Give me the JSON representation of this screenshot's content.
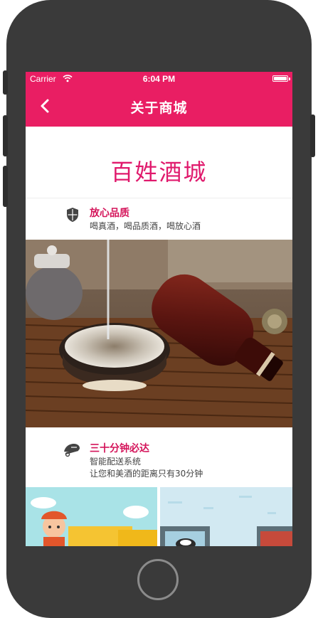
{
  "status_bar": {
    "carrier": "Carrier",
    "time": "6:04 PM"
  },
  "nav": {
    "title": "关于商城"
  },
  "brand": {
    "title": "百姓酒城"
  },
  "features": [
    {
      "title": "放心品质",
      "lines": [
        "喝真酒，喝品质酒，喝放心酒"
      ]
    },
    {
      "title": "三十分钟必达",
      "lines": [
        "智能配送系统",
        "让您和美酒的距离只有30分钟"
      ]
    }
  ],
  "colors": {
    "accent": "#e91e63",
    "brand_text": "#e0196c",
    "frame": "#3a3a3a"
  },
  "icons": {
    "back": "chevron-left-icon",
    "quality": "shield-icon",
    "delivery": "delivery-icon",
    "wifi": "wifi-icon",
    "battery": "battery-icon"
  }
}
